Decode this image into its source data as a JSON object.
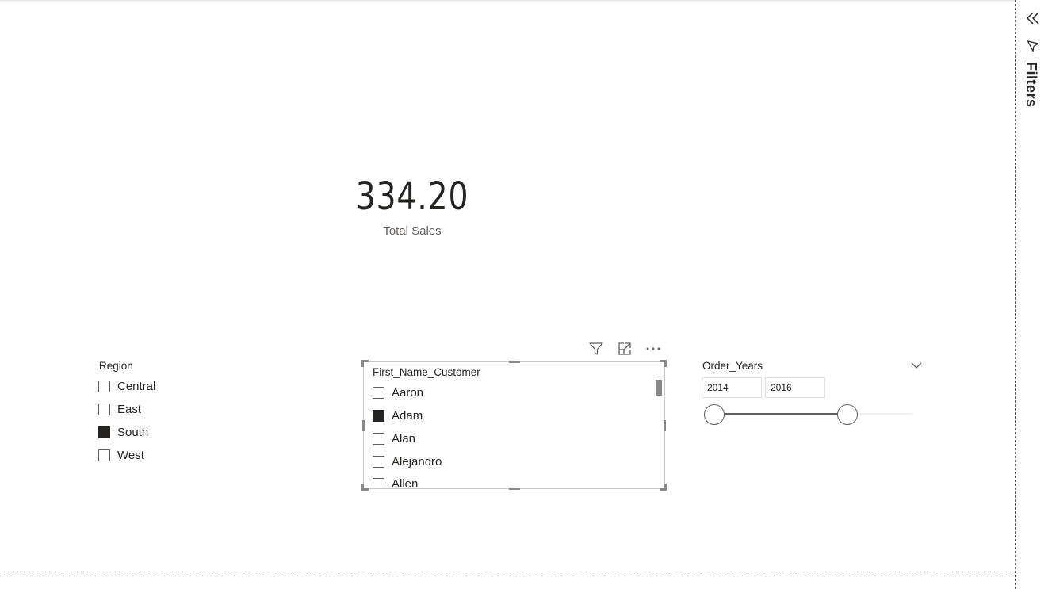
{
  "card": {
    "value": "334.20",
    "label": "Total Sales"
  },
  "region_slicer": {
    "title": "Region",
    "items": [
      {
        "label": "Central",
        "checked": false
      },
      {
        "label": "East",
        "checked": false
      },
      {
        "label": "South",
        "checked": true
      },
      {
        "label": "West",
        "checked": false
      }
    ]
  },
  "name_slicer": {
    "title": "First_Name_Customer",
    "items": [
      {
        "label": "Aaron",
        "checked": false
      },
      {
        "label": "Adam",
        "checked": true
      },
      {
        "label": "Alan",
        "checked": false
      },
      {
        "label": "Alejandro",
        "checked": false
      },
      {
        "label": "Allen",
        "checked": false
      }
    ],
    "header_icons": [
      "filter-icon",
      "focus-mode-icon",
      "more-options-icon"
    ]
  },
  "years_slicer": {
    "title": "Order_Years",
    "from": "2014",
    "to": "2016"
  },
  "filters_pane": {
    "label": "Filters",
    "icons": [
      "collapse-chevrons-icon",
      "filter-icon"
    ]
  },
  "colors": {
    "text": "#252423",
    "secondary_text": "#605e5c",
    "checked_fill": "#252423",
    "border": "#c8c8c8"
  }
}
